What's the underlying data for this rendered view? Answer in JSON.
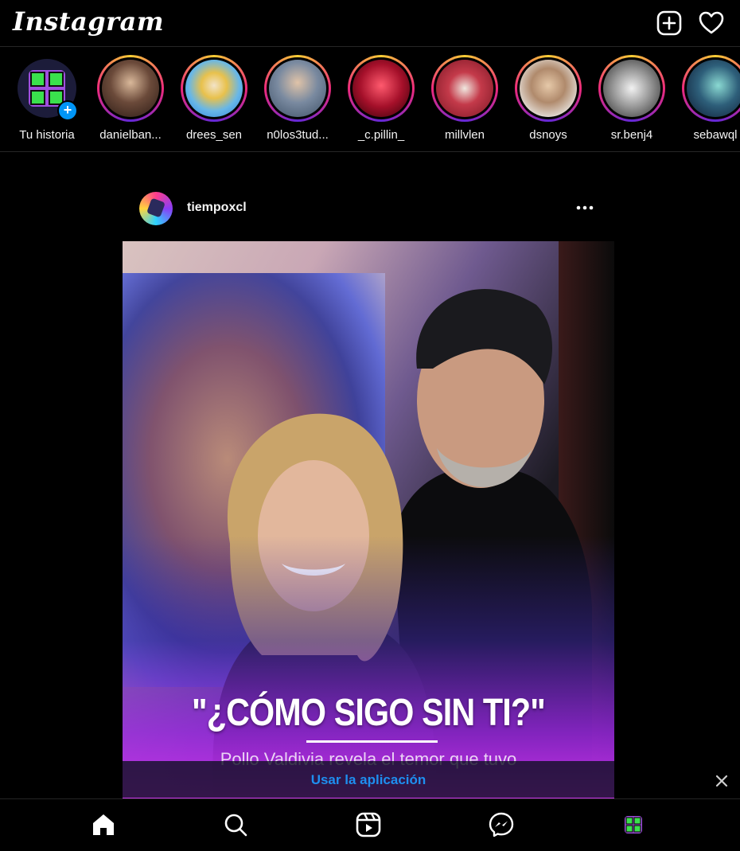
{
  "app": {
    "title": "Instagram"
  },
  "header": {
    "new_post_icon": "plus-square-icon",
    "activity_icon": "heart-icon"
  },
  "stories": [
    {
      "name": "Tu historia",
      "own": true
    },
    {
      "name": "danielban..."
    },
    {
      "name": "drees_sen"
    },
    {
      "name": "n0los3tud..."
    },
    {
      "name": "_c.pillin_"
    },
    {
      "name": "millvlen"
    },
    {
      "name": "dsnoys"
    },
    {
      "name": "sr.benj4"
    },
    {
      "name": "sebawql"
    }
  ],
  "post": {
    "username": "tiempoxcl",
    "image": {
      "headline": "\"¿CÓMO SIGO SIN TI?\"",
      "subline": "Pollo Valdivia revela el temor que tuvo"
    }
  },
  "app_banner": {
    "label": "Usar la aplicación"
  },
  "bottom_nav": [
    "home-icon",
    "search-icon",
    "reels-icon",
    "messenger-icon",
    "profile-icon"
  ],
  "colors": {
    "accent": "#0095f6",
    "background": "#000000",
    "link": "#1e8ff0"
  }
}
